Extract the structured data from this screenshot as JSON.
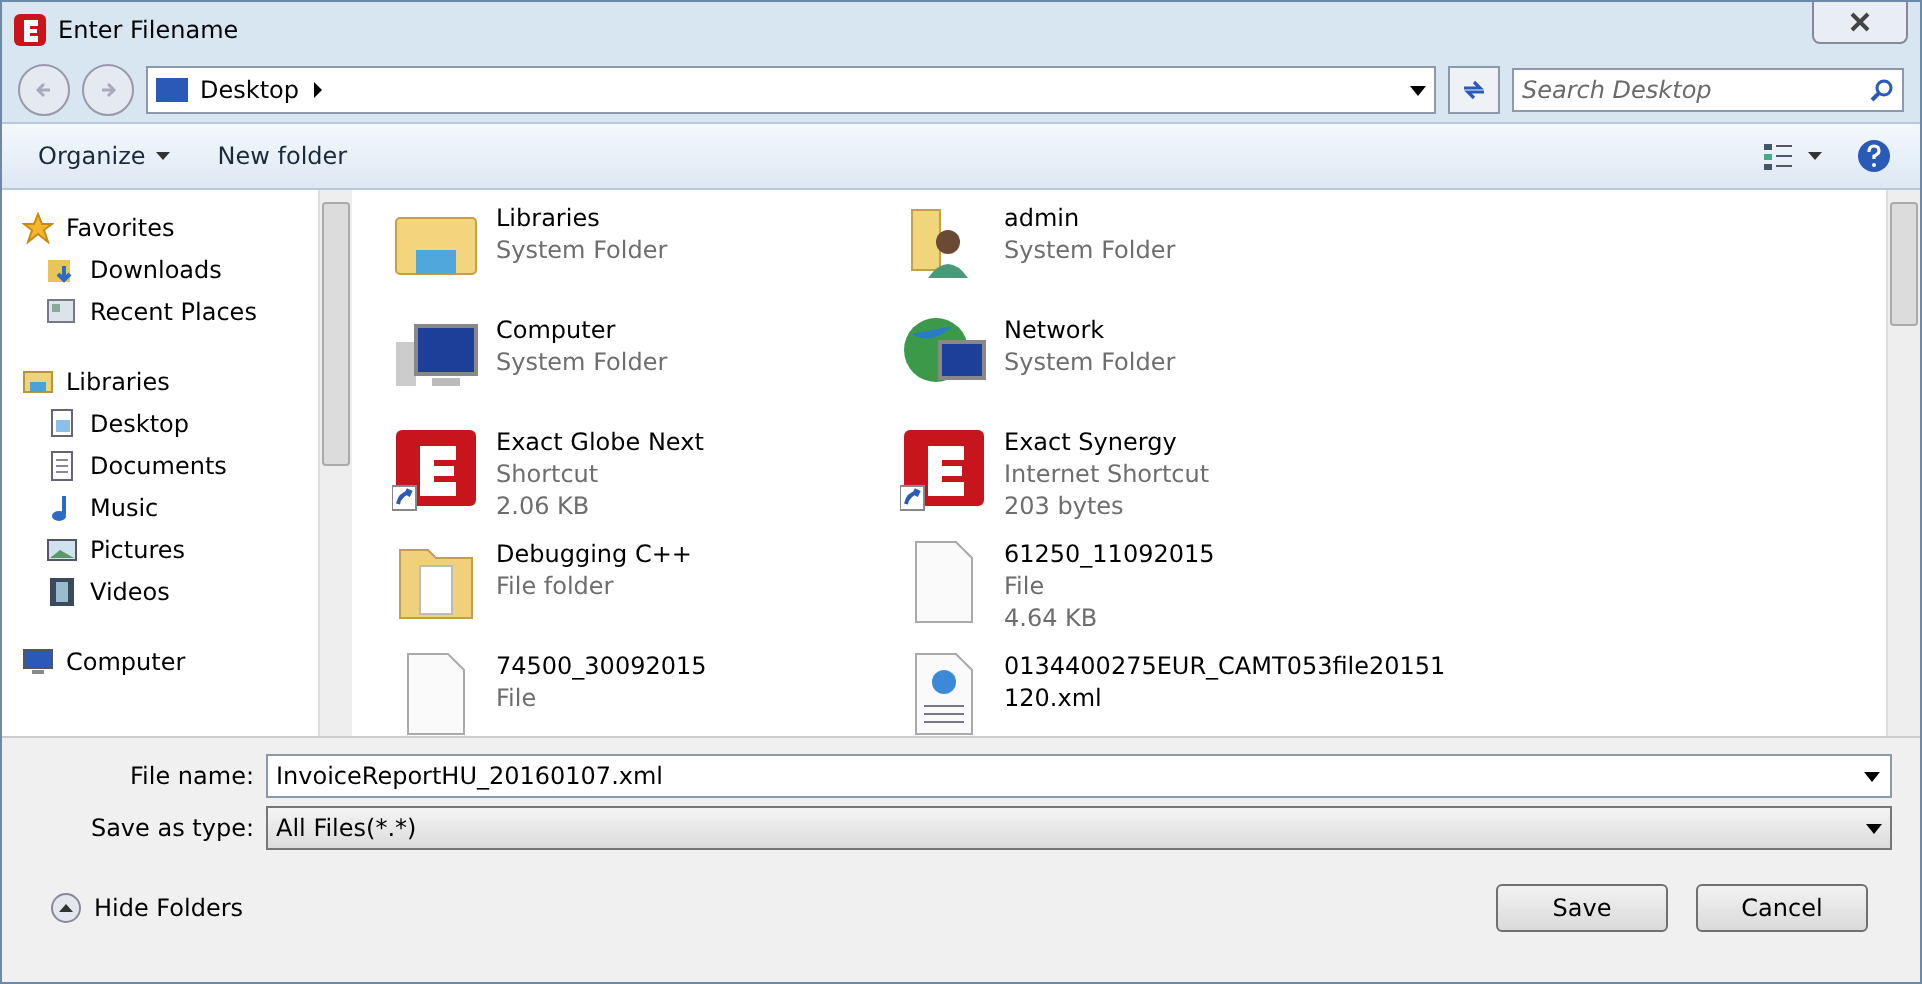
{
  "window": {
    "title": "Enter Filename"
  },
  "address_bar": {
    "location": "Desktop"
  },
  "search": {
    "placeholder": "Search Desktop"
  },
  "toolbar": {
    "organize": "Organize",
    "new_folder": "New folder"
  },
  "sidebar": {
    "groups": [
      {
        "label": "Favorites",
        "kind": "star",
        "children": [
          {
            "label": "Downloads",
            "kind": "download"
          },
          {
            "label": "Recent Places",
            "kind": "recent"
          }
        ]
      },
      {
        "label": "Libraries",
        "kind": "library",
        "children": [
          {
            "label": "Desktop",
            "kind": "desktop"
          },
          {
            "label": "Documents",
            "kind": "document"
          },
          {
            "label": "Music",
            "kind": "music"
          },
          {
            "label": "Pictures",
            "kind": "picture"
          },
          {
            "label": "Videos",
            "kind": "video"
          }
        ]
      },
      {
        "label": "Computer",
        "kind": "computer"
      }
    ]
  },
  "files": [
    {
      "name": "Libraries",
      "kind": "library",
      "details": [
        "System Folder"
      ]
    },
    {
      "name": "admin",
      "kind": "user",
      "details": [
        "System Folder"
      ]
    },
    {
      "name": "Computer",
      "kind": "computer",
      "details": [
        "System Folder"
      ]
    },
    {
      "name": "Network",
      "kind": "network",
      "details": [
        "System Folder"
      ]
    },
    {
      "name": "Exact Globe Next",
      "kind": "shortcut",
      "details": [
        "Shortcut",
        "2.06 KB"
      ]
    },
    {
      "name": "Exact Synergy",
      "kind": "shortcut",
      "details": [
        "Internet Shortcut",
        "203 bytes"
      ]
    },
    {
      "name": "Debugging C++",
      "kind": "folder",
      "details": [
        "File folder"
      ]
    },
    {
      "name": "61250_11092015",
      "kind": "file",
      "details": [
        "File",
        "4.64 KB"
      ]
    },
    {
      "name": "74500_30092015",
      "kind": "file",
      "details": [
        "File"
      ]
    },
    {
      "name": "0134400275EUR_CAMT053file20151120.xml",
      "kind": "xml"
    }
  ],
  "form": {
    "file_name_label": "File name:",
    "file_name": "InvoiceReportHU_20160107.xml",
    "type_label": "Save as type:",
    "type": "All Files(*.*)"
  },
  "footer": {
    "hide_folders": "Hide Folders",
    "buttons": [
      "Save",
      "Cancel"
    ]
  }
}
